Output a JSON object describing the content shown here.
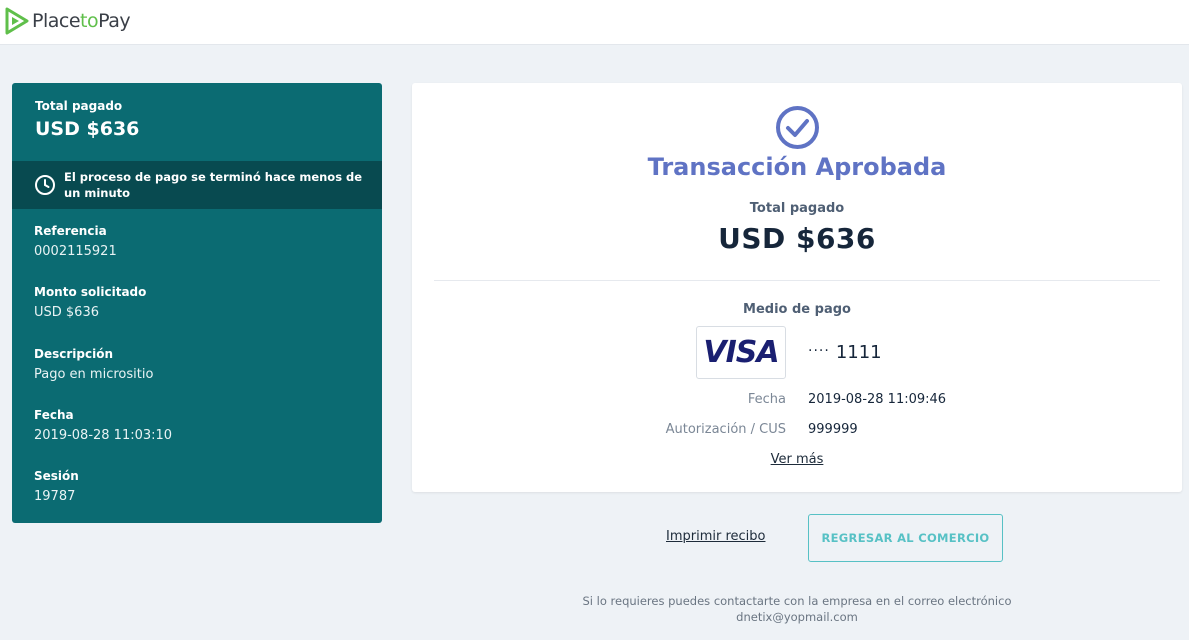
{
  "header": {
    "logo_text_a": "Place",
    "logo_text_b": "to",
    "logo_text_c": "Pay",
    "brand_color": "#5fbf4a"
  },
  "sidebar": {
    "total_label": "Total pagado",
    "total_value": "USD $636",
    "notice": "El proceso de pago se terminó hace menos de un minuto",
    "notice_icon": "clock-icon",
    "items": [
      {
        "label": "Referencia",
        "value": "0002115921"
      },
      {
        "label": "Monto solicitado",
        "value": "USD $636"
      },
      {
        "label": "Descripción",
        "value": "Pago en micrositio"
      },
      {
        "label": "Fecha",
        "value": "2019-08-28 11:03:10"
      },
      {
        "label": "Sesión",
        "value": "19787"
      }
    ],
    "bg_color": "#0b6b72"
  },
  "card": {
    "status_icon": "check-circle-icon",
    "title": "Transacción Aprobada",
    "total_label": "Total pagado",
    "total_value": "USD $636",
    "payment_method_label": "Medio de pago",
    "card_brand": "VISA",
    "card_dots": "····",
    "card_last4": "1111",
    "rows": [
      {
        "label": "Fecha",
        "value": "2019-08-28 11:09:46"
      },
      {
        "label": "Autorización / CUS",
        "value": "999999"
      }
    ],
    "more_link": "Ver más",
    "accent_color": "#5f73c4"
  },
  "actions": {
    "print_label": "Imprimir recibo",
    "return_label": "REGRESAR AL COMERCIO",
    "return_color": "#57c1c5"
  },
  "footer": {
    "line1": "Si lo requieres puedes contactarte con la empresa en el correo electrónico",
    "email": "dnetix@yopmail.com"
  }
}
